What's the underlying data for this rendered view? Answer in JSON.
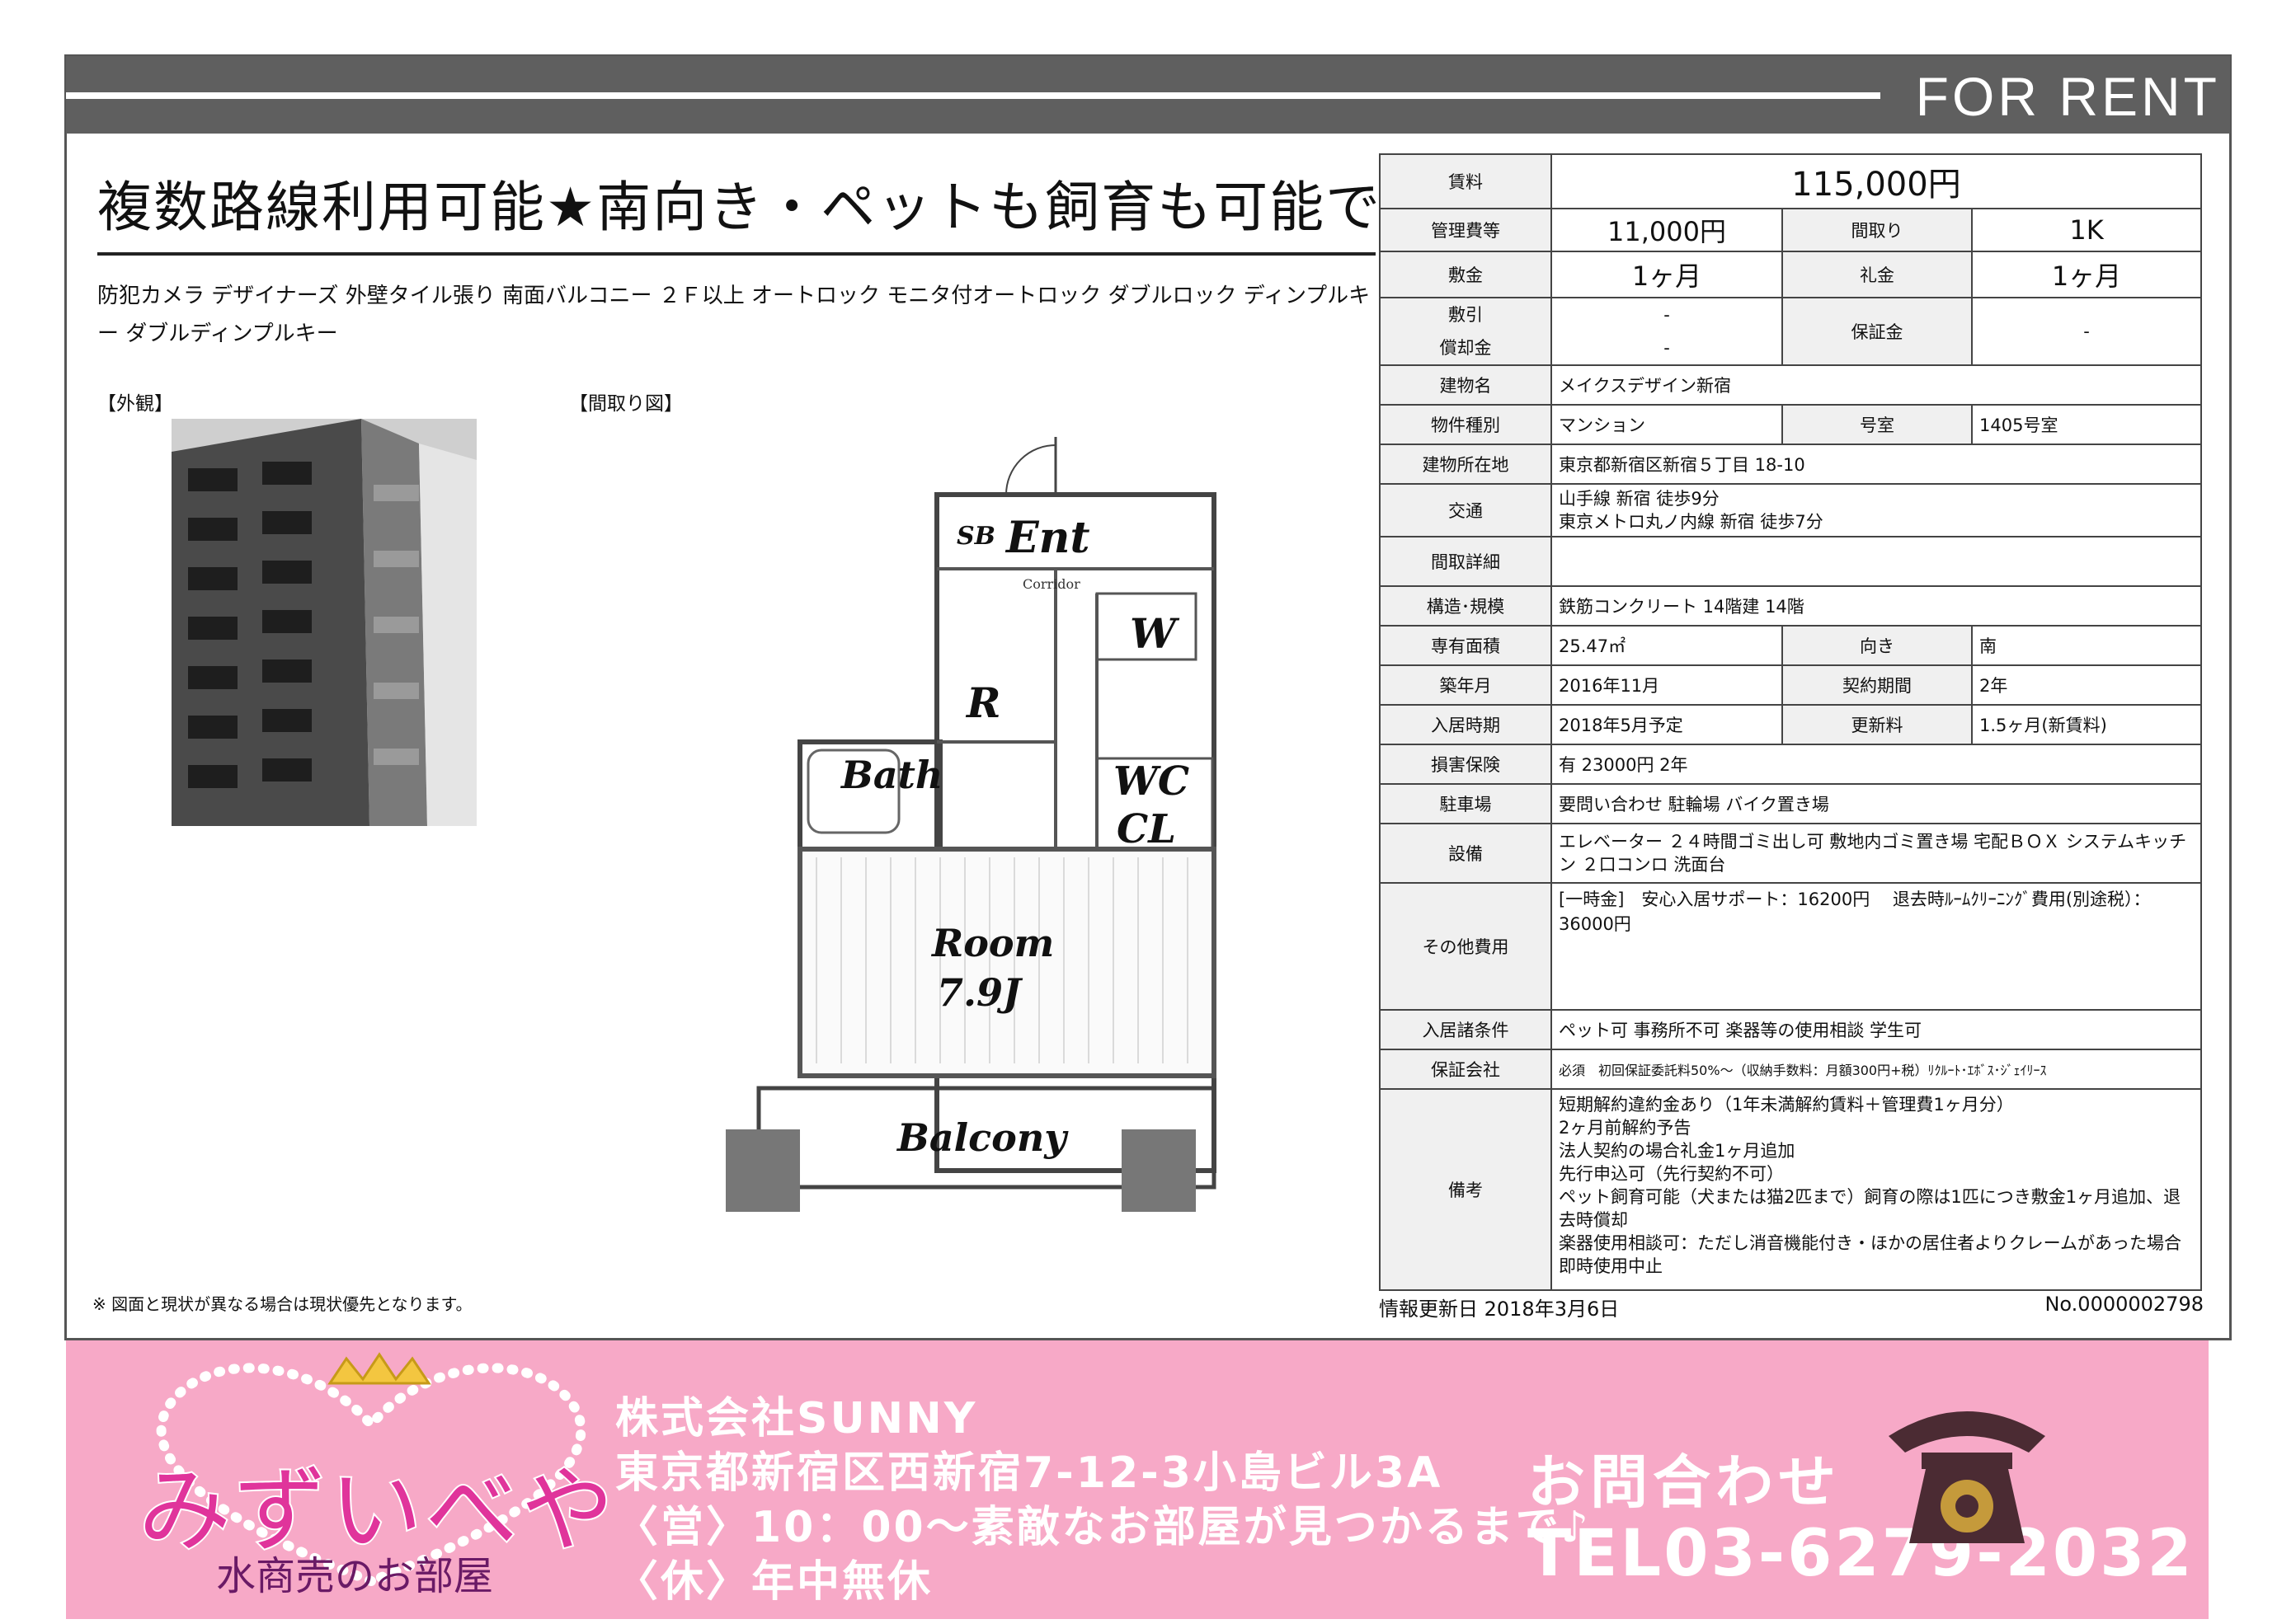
{
  "header": {
    "title": "FOR RENT"
  },
  "headline": "複数路線利用可能★南向き・ペットも飼育も可能で",
  "features": "防犯カメラ デザイナーズ 外壁タイル張り 南面バルコニー ２Ｆ以上 オートロック モニタ付オートロック ダブルロック ディンプルキー ダブルディンプルキー",
  "labels": {
    "exterior": "【外観】",
    "floorplan": "【間取り図】"
  },
  "floorplan": {
    "ent": "Ent",
    "sb": "SB",
    "corridor": "Corridor",
    "w": "W",
    "r": "R",
    "bath": "Bath",
    "wc": "WC",
    "cl": "CL",
    "room": "Room",
    "room_size": "7.9J",
    "balcony": "Balcony"
  },
  "notice": "※ 図面と現状が異なる場合は現状優先となります。",
  "property": {
    "rent_label": "賃料",
    "rent": "115,000円",
    "mgmt_label": "管理費等",
    "mgmt": "11,000円",
    "layout_label": "間取り",
    "layout": "1K",
    "deposit_label": "敷金",
    "deposit": "1ヶ月",
    "keymoney_label": "礼金",
    "keymoney": "1ヶ月",
    "shikibiki_label": "敷引",
    "shikibiki": "-",
    "shokyaku_label": "償却金",
    "shokyaku": "-",
    "guarantee_label": "保証金",
    "guarantee": "-",
    "building_label": "建物名",
    "building": "メイクスデザイン新宿",
    "type_label": "物件種別",
    "type": "マンション",
    "room_label": "号室",
    "room": "1405号室",
    "address_label": "建物所在地",
    "address": "東京都新宿区新宿５丁目 18-10",
    "transport_label": "交通",
    "transport1": "山手線 新宿 徒歩9分",
    "transport2": "東京メトロ丸ノ内線 新宿 徒歩7分",
    "layout_detail_label": "間取詳細",
    "layout_detail": "",
    "structure_label": "構造･規模",
    "structure": "鉄筋コンクリート 14階建 14階",
    "area_label": "専有面積",
    "area": "25.47㎡",
    "direction_label": "向き",
    "direction": "南",
    "built_label": "築年月",
    "built": "2016年11月",
    "contract_label": "契約期間",
    "contract": "2年",
    "movein_label": "入居時期",
    "movein": "2018年5月予定",
    "renewal_label": "更新料",
    "renewal": "1.5ヶ月(新賃料)",
    "insurance_label": "損害保険",
    "insurance": "有  23000円 2年",
    "parking_label": "駐車場",
    "parking": "要問い合わせ 駐輪場 バイク置き場",
    "facilities_label": "設備",
    "facilities": "エレベーター ２４時間ゴミ出し可 敷地内ゴミ置き場 宅配ＢＯＸ システムキッチン ２口コンロ 洗面台",
    "other_label": "その他費用",
    "other": "[一時金]　安心入居サポート：16200円　 退去時ﾙｰﾑｸﾘｰﾆﾝｸﾞ費用(別途税）：36000円",
    "conditions_label": "入居諸条件",
    "conditions": "ペット可 事務所不可 楽器等の使用相談 学生可",
    "guarantor_label": "保証会社",
    "guarantor": "必須　初回保証委託料50%～（収納手数料：月額300円+税）ﾘｸﾙｰﾄ･ｴﾎﾞｽ･ｼﾞｪｲﾘｰｽ",
    "remarks_label": "備考",
    "remarks": [
      "短期解約違約金あり（1年未満解約賃料＋管理費1ヶ月分）",
      "2ヶ月前解約予告",
      "法人契約の場合礼金1ヶ月追加",
      "先行申込可（先行契約不可）",
      "ペット飼育可能（犬または猫2匹まで）飼育の際は1匹につき敷金1ヶ月追加、退去時償却",
      "楽器使用相談可：ただし消音機能付き・ほかの居住者よりクレームがあった場合即時使用中止"
    ]
  },
  "updated": "情報更新日 2018年3月6日",
  "doc_no": "No.0000002798",
  "footer": {
    "logo": "みずいべや",
    "logo_sub": "水商売のお部屋",
    "company": "株式会社SUNNY",
    "address": "東京都新宿区西新宿7-12-3小島ビル3A",
    "hours": "〈営〉10：00～素敵なお部屋が見つかるまで♪",
    "holiday": "〈休〉年中無休",
    "contact_label": "お問合わせ",
    "tel": "TEL03-6279-2032"
  },
  "colors": {
    "header": "#5f5f5f",
    "footer_bg": "#f7a9c7",
    "logo": "#e0349b"
  }
}
